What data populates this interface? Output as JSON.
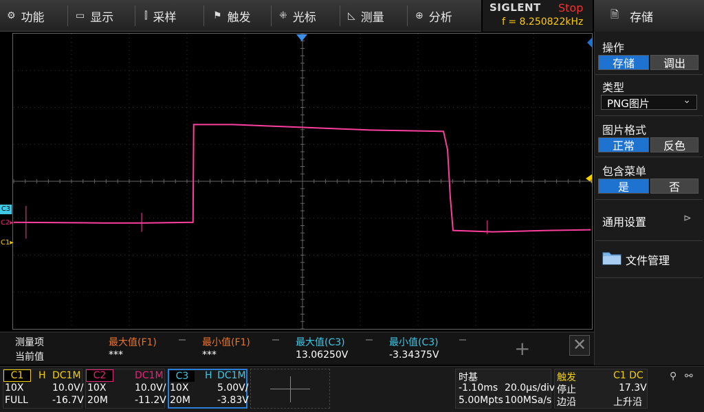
{
  "menu": {
    "items": [
      {
        "icon": "⚙",
        "label": "功能"
      },
      {
        "icon": "▭",
        "label": "显示"
      },
      {
        "icon": "⫿",
        "label": "采样"
      },
      {
        "icon": "⚑",
        "label": "触发"
      },
      {
        "icon": "⁜",
        "label": "光标"
      },
      {
        "icon": "◺",
        "label": "测量"
      },
      {
        "icon": "⊕",
        "label": "分析"
      }
    ]
  },
  "brand": {
    "logo": "SIGLENT",
    "state": "Stop",
    "freq": "f = 8.250822kHz"
  },
  "panel": {
    "title": "存储",
    "title_icon": "🗎",
    "op_label": "操作",
    "op_on": "存储",
    "op_off": "调出",
    "type_label": "类型",
    "type_value": "PNG图片",
    "fmt_label": "图片格式",
    "fmt_on": "正常",
    "fmt_off": "反色",
    "menu_label": "包含菜单",
    "menu_on": "是",
    "menu_off": "否",
    "general": "通用设置",
    "general_icon": "⊳",
    "files": "文件管理"
  },
  "markers": {
    "c3": "C3",
    "c2": "C2▸",
    "c1": "C1▸"
  },
  "measure": {
    "header": "测量项",
    "row_label": "当前值",
    "cols": [
      {
        "name": "最大值(F1)",
        "value": "***",
        "color": "#e8742c"
      },
      {
        "name": "最小值(F1)",
        "value": "***",
        "color": "#e8742c"
      },
      {
        "name": "最大值(C3)",
        "value": "13.06250V",
        "color": "#3fc8e6"
      },
      {
        "name": "最小值(C3)",
        "value": "-3.34375V",
        "color": "#3fc8e6"
      }
    ]
  },
  "channels": [
    {
      "name": "C1",
      "h": "H",
      "coupling": "DC1M",
      "probe": "10X",
      "scale": "10.0V/",
      "bw": "FULL",
      "offset": "-16.7V",
      "color": "#f5d000"
    },
    {
      "name": "C2",
      "h": "",
      "coupling": "DC1M",
      "probe": "10X",
      "scale": "10.0V/",
      "bw": "20M",
      "offset": "-11.2V",
      "color": "#e8237a"
    },
    {
      "name": "C3",
      "h": "H",
      "coupling": "DC1M",
      "probe": "10X",
      "scale": "5.00V/",
      "bw": "20M",
      "offset": "-3.83V",
      "color": "#3fc8e6"
    }
  ],
  "timebase": {
    "label": "时基",
    "delay": "-1.10ms",
    "scale": "20.0µs/div",
    "points": "5.00Mpts",
    "rate": "100MSa/s"
  },
  "trigger": {
    "label": "触发",
    "source": "C1 DC",
    "state": "停止",
    "level": "17.3V",
    "mode_label": "边沿",
    "slope": "上升沿"
  },
  "status_icons": [
    "usb-icon",
    "network-icon"
  ],
  "trace_color": "#ff3fa0"
}
